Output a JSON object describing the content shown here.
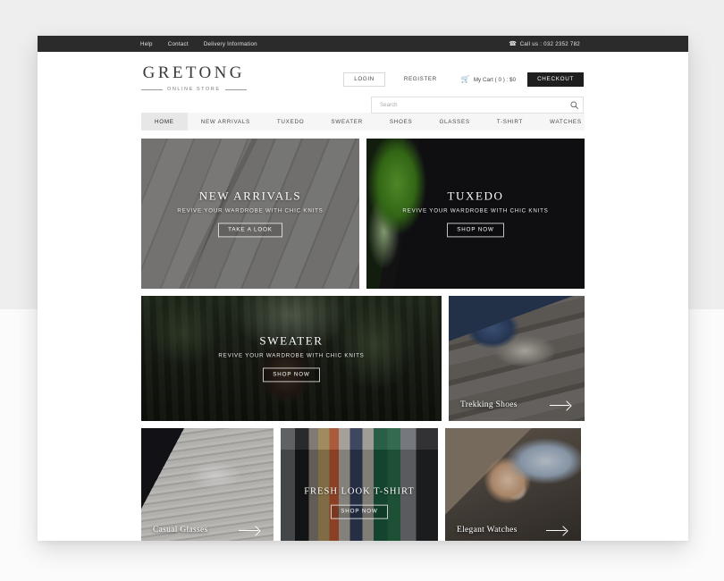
{
  "topbar": {
    "links": [
      "Help",
      "Contact",
      "Delivery Information"
    ],
    "phone_label": "Call us : 032 2352 782",
    "phone_icon": "phone-icon",
    "background": "#2b2b2b"
  },
  "header": {
    "logo_name": "GRETONG",
    "logo_subtitle": "ONLINE STORE",
    "login_label": "LOGIN",
    "register_label": "REGISTER",
    "cart_label": "My Cart ( 0 ) : $0",
    "cart_icon": "shopping-cart-icon",
    "checkout_label": "CHECKOUT",
    "checkout_background": "#1e1e1e",
    "search_placeholder": "Search",
    "search_value": "",
    "search_icon": "search-icon"
  },
  "nav": {
    "items": [
      {
        "label": "HOME",
        "active": true
      },
      {
        "label": "NEW ARRIVALS",
        "active": false
      },
      {
        "label": "TUXEDO",
        "active": false
      },
      {
        "label": "SWEATER",
        "active": false
      },
      {
        "label": "SHOES",
        "active": false
      },
      {
        "label": "GLASSES",
        "active": false
      },
      {
        "label": "T-SHIRT",
        "active": false
      },
      {
        "label": "WATCHES",
        "active": false
      }
    ],
    "background": "#f6f6f6",
    "active_background": "#e7e7e7"
  },
  "tiles": {
    "new_arrivals": {
      "title": "NEW ARRIVALS",
      "subtitle": "REVIVE YOUR WARDROBE WITH CHIC KNITS",
      "button": "TAKE A LOOK"
    },
    "tuxedo": {
      "title": "TUXEDO",
      "subtitle": "REVIVE YOUR WARDROBE WITH CHIC KNITS",
      "button": "SHOP NOW"
    },
    "sweater": {
      "title": "SWEATER",
      "subtitle": "REVIVE YOUR WARDROBE WITH CHIC KNITS",
      "button": "SHOP NOW"
    },
    "trekking_shoes": {
      "title": "Trekking Shoes",
      "arrow_icon": "arrow-right-icon"
    },
    "casual_glasses": {
      "title": "Casual Glasses",
      "arrow_icon": "arrow-right-icon"
    },
    "fresh_look_tshirt": {
      "title": "FRESH LOOK T-SHIRT",
      "button": "SHOP NOW"
    },
    "elegant_watches": {
      "title": "Elegant Watches",
      "arrow_icon": "arrow-right-icon"
    }
  }
}
